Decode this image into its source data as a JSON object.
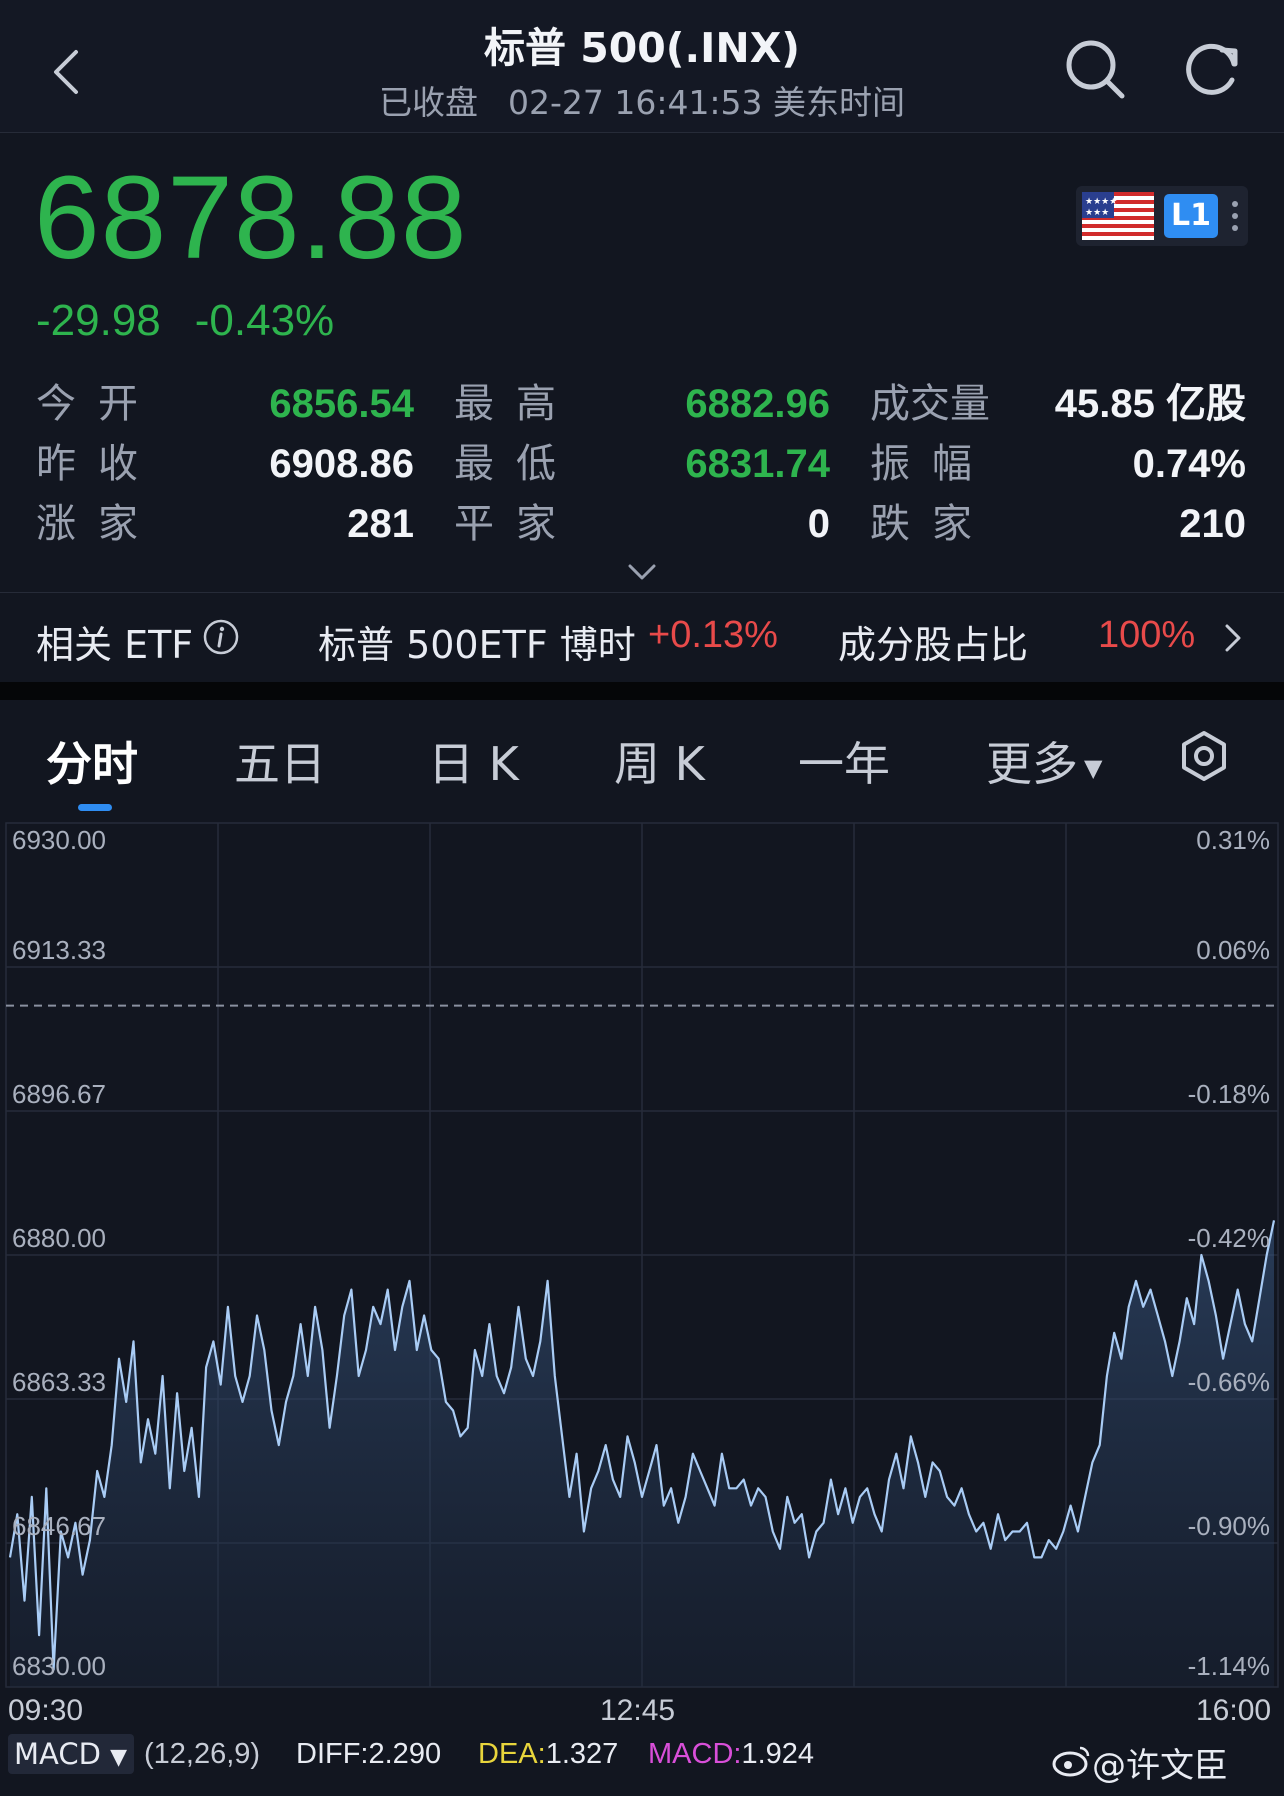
{
  "header": {
    "title": "标普 500(.INX)",
    "status": "已收盘",
    "time": "02-27 16:41:53 美东时间"
  },
  "quote": {
    "price": "6878.88",
    "change": "-29.98",
    "change_pct": "-0.43%",
    "badge": "L1"
  },
  "stats": {
    "open_label": "今开",
    "open": "6856.54",
    "high_label": "最高",
    "high": "6882.96",
    "volume_label": "成交量",
    "volume": "45.85 亿股",
    "prev_close_label": "昨收",
    "prev_close": "6908.86",
    "low_label": "最低",
    "low": "6831.74",
    "amplitude_label": "振幅",
    "amplitude": "0.74%",
    "up_label": "涨家",
    "up": "281",
    "flat_label": "平家",
    "flat": "0",
    "down_label": "跌家",
    "down": "210"
  },
  "etf": {
    "label": "相关 ETF",
    "name": "标普 500ETF 博时",
    "pct": "+0.13%",
    "component_label": "成分股占比",
    "component_pct": "100%"
  },
  "tabs": [
    "分时",
    "五日",
    "日 K",
    "周 K",
    "一年",
    "更多"
  ],
  "chart_data": {
    "type": "line",
    "y_left_ticks": [
      "6930.00",
      "6913.33",
      "6896.67",
      "6880.00",
      "6863.33",
      "6846.67",
      "6830.00"
    ],
    "y_right_ticks": [
      "0.31%",
      "0.06%",
      "-0.18%",
      "-0.42%",
      "-0.66%",
      "-0.90%",
      "-1.14%"
    ],
    "x_ticks": [
      "09:30",
      "12:45",
      "16:00"
    ],
    "ylim": [
      6830,
      6930
    ],
    "prev_close": 6908.86,
    "series": [
      {
        "values": [
          6845,
          6850,
          6840,
          6852,
          6836,
          6853,
          6832,
          6848,
          6845,
          6849,
          6843,
          6847,
          6855,
          6852,
          6858,
          6868,
          6863,
          6870,
          6856,
          6861,
          6857,
          6866,
          6853,
          6864,
          6855,
          6860,
          6852,
          6867,
          6870,
          6865,
          6874,
          6866,
          6863,
          6866,
          6873,
          6869,
          6862,
          6858,
          6863,
          6866,
          6872,
          6866,
          6874,
          6869,
          6860,
          6866,
          6873,
          6876,
          6866,
          6869,
          6874,
          6872,
          6876,
          6869,
          6874,
          6877,
          6869,
          6873,
          6869,
          6868,
          6863,
          6862,
          6859,
          6860,
          6869,
          6866,
          6872,
          6866,
          6864,
          6867,
          6874,
          6868,
          6866,
          6870,
          6877,
          6866,
          6859,
          6852,
          6857,
          6848,
          6853,
          6855,
          6858,
          6854,
          6852,
          6859,
          6856,
          6852,
          6855,
          6858,
          6851,
          6853,
          6849,
          6852,
          6857,
          6855,
          6853,
          6851,
          6857,
          6853,
          6853,
          6854,
          6851,
          6853,
          6852,
          6848,
          6846,
          6852,
          6849,
          6850,
          6845,
          6848,
          6849,
          6854,
          6850,
          6853,
          6849,
          6852,
          6853,
          6850,
          6848,
          6854,
          6857,
          6853,
          6859,
          6856,
          6852,
          6856,
          6855,
          6852,
          6851,
          6853,
          6850,
          6848,
          6849,
          6846,
          6850,
          6847,
          6848,
          6848,
          6849,
          6845,
          6845,
          6847,
          6846,
          6848,
          6851,
          6848,
          6852,
          6856,
          6858,
          6866,
          6871,
          6868,
          6874,
          6877,
          6874,
          6876,
          6873,
          6870,
          6866,
          6870,
          6875,
          6872,
          6880,
          6877,
          6873,
          6868,
          6872,
          6876,
          6872,
          6870,
          6875,
          6880,
          6884
        ]
      }
    ]
  },
  "macd": {
    "name": "MACD",
    "params": "(12,26,9)",
    "diff_label": "DIFF:",
    "diff": "2.290",
    "dea_label": "DEA:",
    "dea": "1.327",
    "macd_label": "MACD:",
    "macd": "1.924",
    "diff_color": "#e8ebf2",
    "dea_color": "#e8d53c",
    "macd_color": "#d94fd9"
  },
  "watermark": "@许文臣",
  "colors": {
    "down": "#2eb44e",
    "up": "#e84a4a",
    "accent": "#2f8df2",
    "line": "#a9ccf5"
  }
}
